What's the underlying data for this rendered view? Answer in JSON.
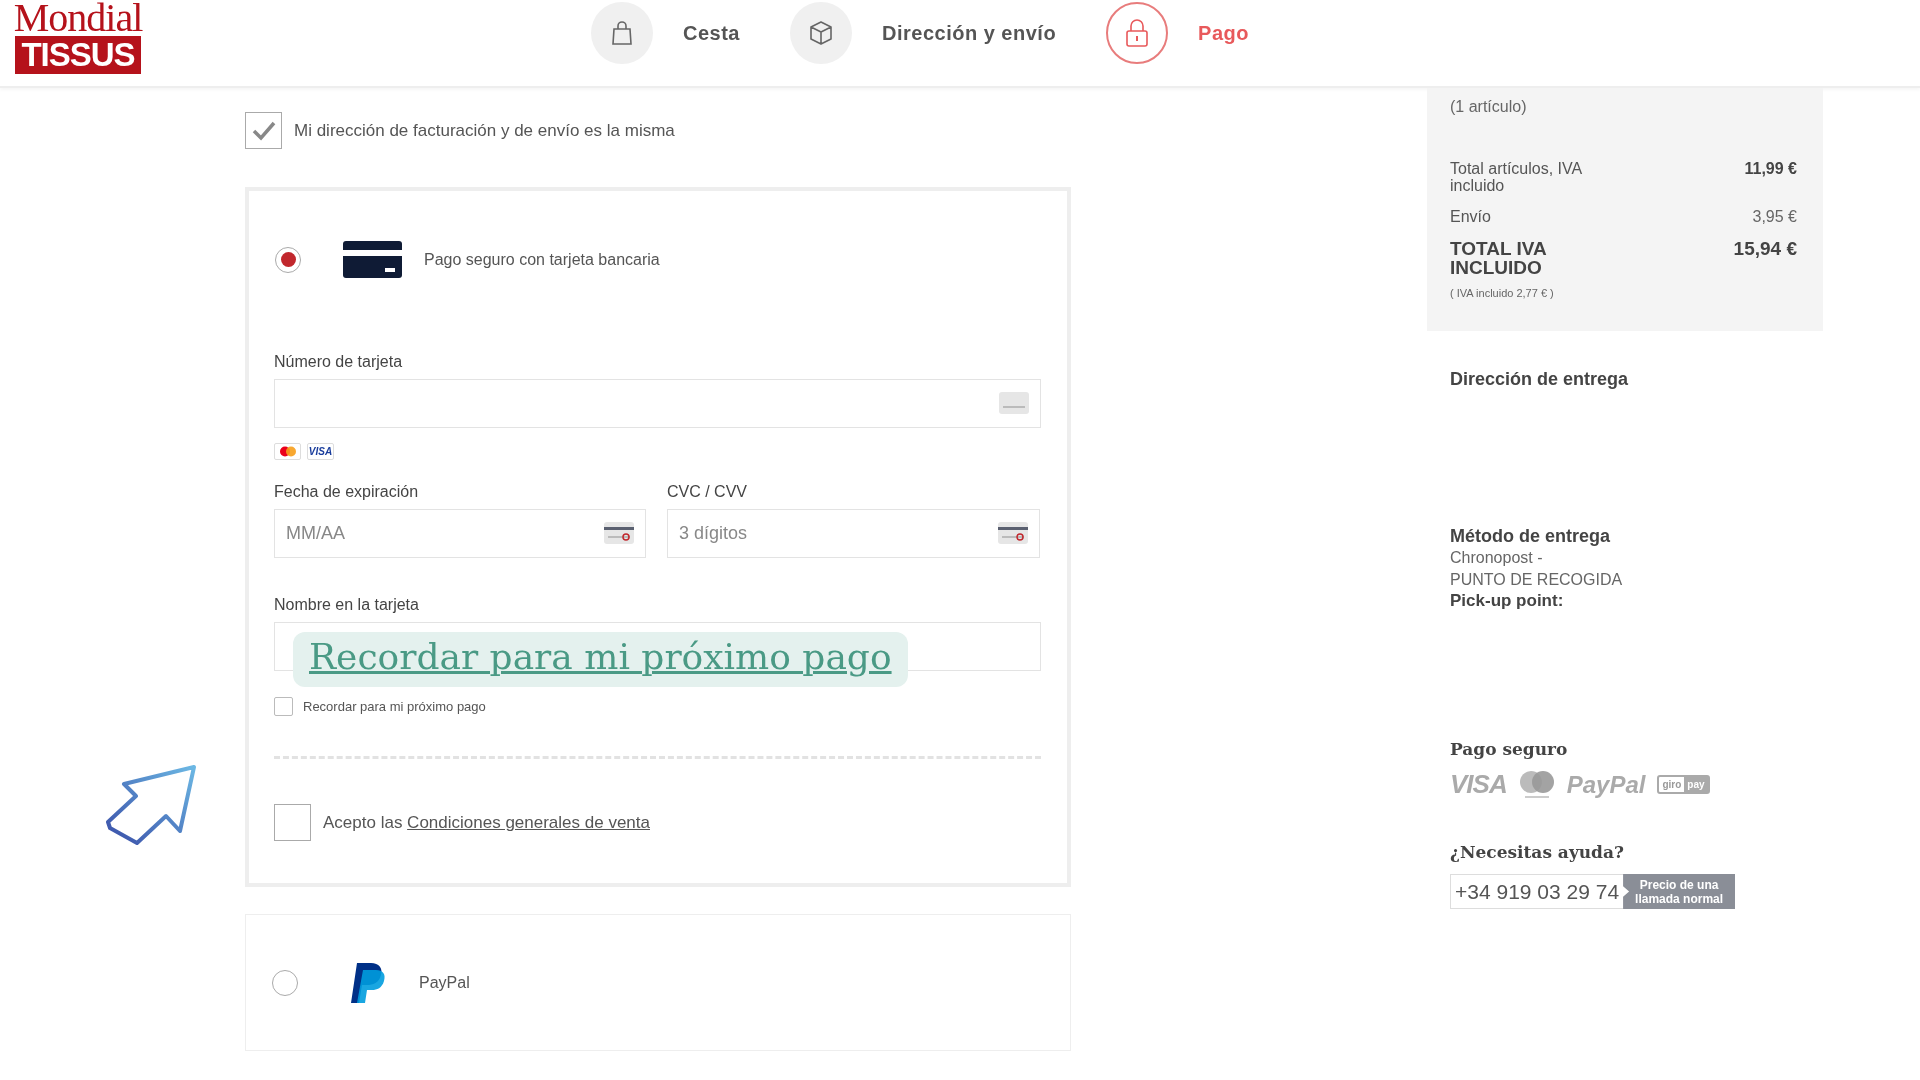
{
  "header": {
    "logo": {
      "line1": "Mondial",
      "line2": "TISSUS"
    },
    "steps": [
      {
        "kind": "bag",
        "label": "Cesta",
        "selected": false
      },
      {
        "kind": "box",
        "label": "Dirección y envío",
        "selected": false
      },
      {
        "kind": "lock",
        "label": "Pago",
        "selected": true
      }
    ]
  },
  "same_address": {
    "label": "Mi dirección de facturación y de envío es la misma",
    "checked": true
  },
  "payment_methods": [
    {
      "kind": "card",
      "label": "Pago seguro con tarjeta bancaria",
      "selected": true
    },
    {
      "kind": "paypal",
      "label": "PayPal",
      "selected": false
    }
  ],
  "card_form": {
    "number_label": "Número de tarjeta",
    "card_brands": [
      {
        "kind": "mastercard"
      },
      {
        "kind": "visa",
        "text": "VISA"
      }
    ],
    "expiry_label": "Fecha de expiración",
    "expiry_placeholder": "MM/AA",
    "cvc_label": "CVC / CVV",
    "cvc_placeholder": "3 dígitos",
    "name_label": "Nombre en la tarjeta",
    "remember": {
      "label": "Recordar para mi próximo pago",
      "checked": false
    },
    "tooltip": "Recordar para mi próximo pago",
    "terms": {
      "prefix": "Acepto las",
      "link": "Condiciones generales de venta",
      "checked": false
    }
  },
  "order_summary": {
    "count": "(1 artículo)",
    "rows": [
      {
        "kind": "normal",
        "label": "Total artículos, IVA incluido",
        "value": "11,99 €"
      },
      {
        "kind": "light",
        "label": "Envío",
        "value": "3,95 €"
      },
      {
        "kind": "total",
        "label": "TOTAL IVA INCLUIDO",
        "value": "15,94 €"
      }
    ],
    "vat_note": "( IVA incluido 2,77 € )"
  },
  "delivery_address": {
    "title": "Dirección de entrega"
  },
  "delivery_method": {
    "title": "Método de entrega",
    "lines": [
      "Chronopost -",
      "PUNTO DE RECOGIDA"
    ],
    "pickup_label": "Pick-up point:"
  },
  "secure_payment": {
    "title": "Pago seguro",
    "logos": [
      {
        "kind": "visa",
        "text": "VISA"
      },
      {
        "kind": "mastercard"
      },
      {
        "kind": "paypal",
        "text": "PayPal"
      },
      {
        "kind": "giropay",
        "text": [
          "giro",
          "pay"
        ]
      }
    ]
  },
  "help": {
    "title": "¿Necesitas ayuda?",
    "phone": "+34 919 03 29 74",
    "price_note": "Precio de una llamada normal"
  }
}
